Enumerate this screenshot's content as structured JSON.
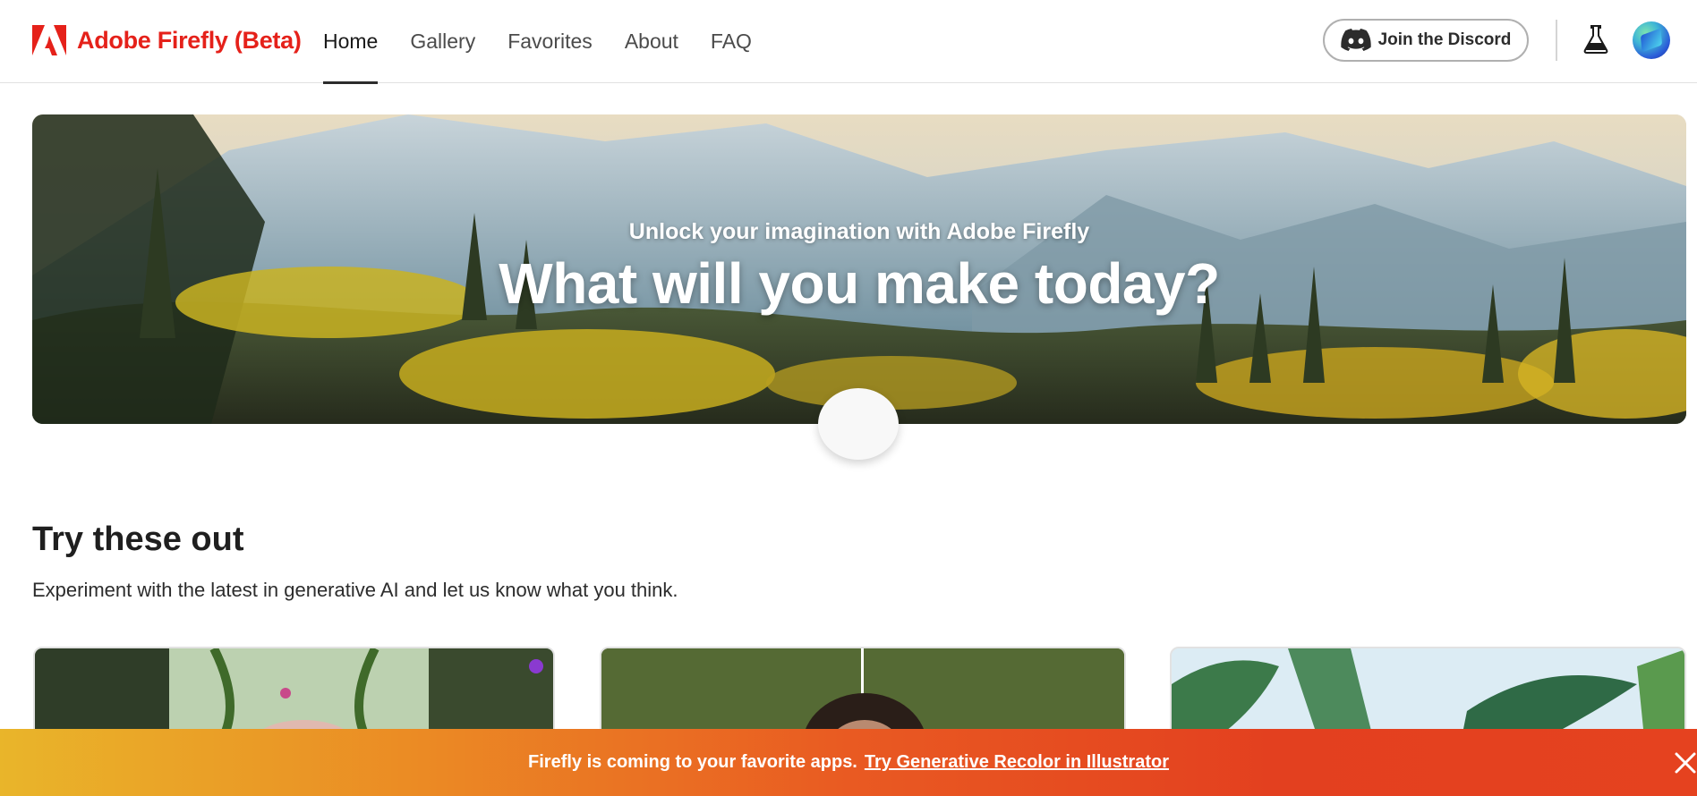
{
  "header": {
    "brand": "Adobe Firefly (Beta)",
    "logo_icon": "adobe-logo",
    "nav": [
      {
        "label": "Home",
        "active": true
      },
      {
        "label": "Gallery",
        "active": false
      },
      {
        "label": "Favorites",
        "active": false
      },
      {
        "label": "About",
        "active": false
      },
      {
        "label": "FAQ",
        "active": false
      }
    ],
    "discord_label": "Join the Discord",
    "discord_icon": "discord-icon",
    "labs_icon": "flask-icon",
    "avatar_icon": "user-avatar"
  },
  "hero": {
    "subtitle": "Unlock your imagination with Adobe Firefly",
    "title": "What will you make today?"
  },
  "try": {
    "title": "Try these out",
    "description": "Experiment with the latest in generative AI and let us know what you think."
  },
  "banner": {
    "text": "Firefly is coming to your favorite apps.",
    "link": "Try Generative Recolor in Illustrator",
    "close_icon": "close-icon"
  },
  "colors": {
    "brand_red": "#e5211a",
    "banner_start": "#e9b52a",
    "banner_end": "#e5421f"
  }
}
